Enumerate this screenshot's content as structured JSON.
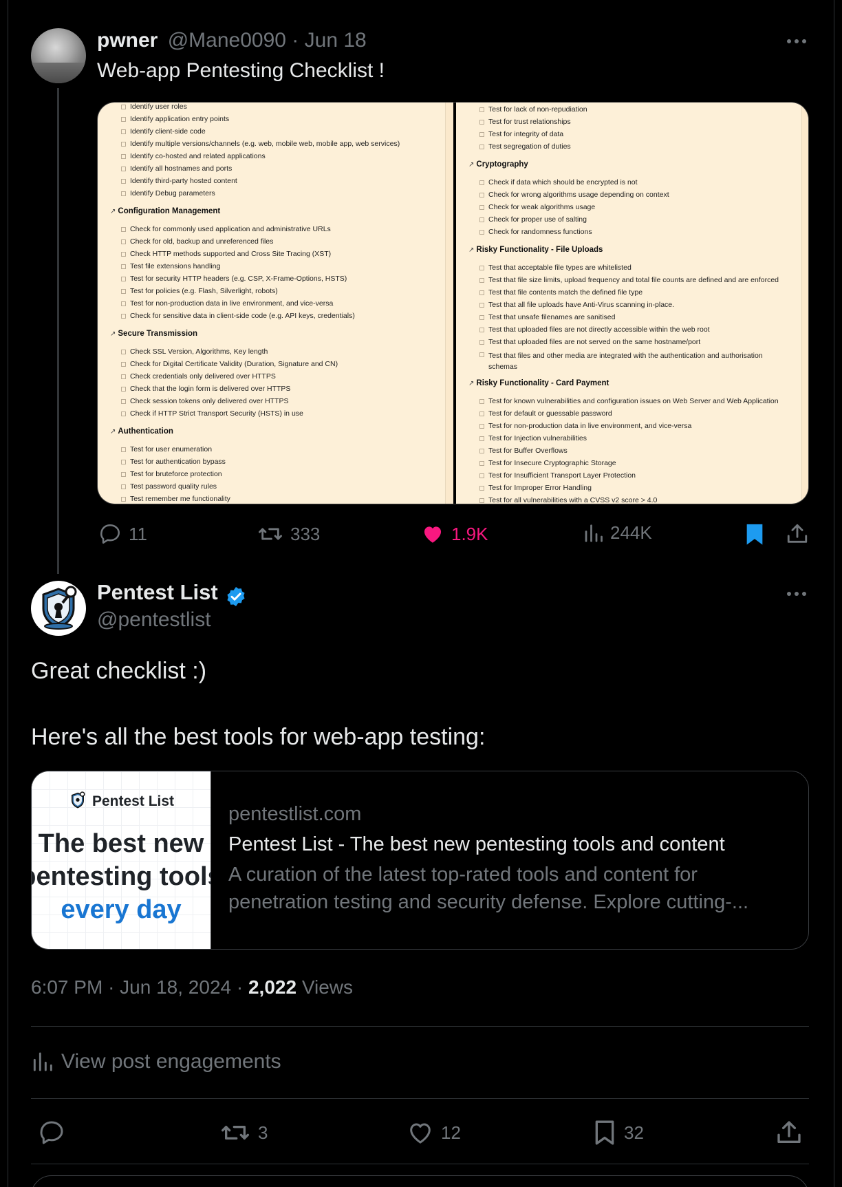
{
  "original_post": {
    "author_name": "pwner",
    "handle": "@Mane0090",
    "separator": "·",
    "date": "Jun 18",
    "text": "Web-app Pentesting Checklist !",
    "stats": {
      "replies": "11",
      "reposts": "333",
      "likes": "1.9K",
      "views": "244K"
    },
    "checklist_left": [
      {
        "type": "item",
        "text": "Identify user roles"
      },
      {
        "type": "item",
        "text": "Identify application entry points"
      },
      {
        "type": "item",
        "text": "Identify client-side code"
      },
      {
        "type": "item",
        "text": "Identify multiple versions/channels (e.g. web, mobile web, mobile app, web services)"
      },
      {
        "type": "item",
        "text": "Identify co-hosted and related applications"
      },
      {
        "type": "item",
        "text": "Identify all hostnames and ports"
      },
      {
        "type": "item",
        "text": "Identify third-party hosted content"
      },
      {
        "type": "item",
        "text": "Identify Debug parameters"
      },
      {
        "type": "section",
        "text": "Configuration Management"
      },
      {
        "type": "item",
        "text": "Check for commonly used application and administrative URLs"
      },
      {
        "type": "item",
        "text": "Check for old, backup and unreferenced files"
      },
      {
        "type": "item",
        "text": "Check HTTP methods supported and Cross Site Tracing (XST)"
      },
      {
        "type": "item",
        "text": "Test file extensions handling"
      },
      {
        "type": "item",
        "text": "Test for security HTTP headers (e.g. CSP, X-Frame-Options, HSTS)"
      },
      {
        "type": "item",
        "text": "Test for policies (e.g. Flash, Silverlight, robots)"
      },
      {
        "type": "item",
        "text": "Test for non-production data in live environment, and vice-versa"
      },
      {
        "type": "item",
        "text": "Check for sensitive data in client-side code (e.g. API keys, credentials)"
      },
      {
        "type": "section",
        "text": "Secure Transmission"
      },
      {
        "type": "item",
        "text": "Check SSL Version, Algorithms, Key length"
      },
      {
        "type": "item",
        "text": "Check for Digital Certificate Validity (Duration, Signature and CN)"
      },
      {
        "type": "item",
        "text": "Check credentials only delivered over HTTPS"
      },
      {
        "type": "item",
        "text": "Check that the login form is delivered over HTTPS"
      },
      {
        "type": "item",
        "text": "Check session tokens only delivered over HTTPS"
      },
      {
        "type": "item",
        "text": "Check if HTTP Strict Transport Security (HSTS) in use"
      },
      {
        "type": "section",
        "text": "Authentication"
      },
      {
        "type": "item",
        "text": "Test for user enumeration"
      },
      {
        "type": "item",
        "text": "Test for authentication bypass"
      },
      {
        "type": "item",
        "text": "Test for bruteforce protection"
      },
      {
        "type": "item",
        "text": "Test password quality rules"
      },
      {
        "type": "item",
        "text": "Test remember me functionality"
      }
    ],
    "checklist_right": [
      {
        "type": "item",
        "text": "Test for lack of non-repudiation"
      },
      {
        "type": "item",
        "text": "Test for trust relationships"
      },
      {
        "type": "item",
        "text": "Test for integrity of data"
      },
      {
        "type": "item",
        "text": "Test segregation of duties"
      },
      {
        "type": "section",
        "text": "Cryptography"
      },
      {
        "type": "item",
        "text": "Check if data which should be encrypted is not"
      },
      {
        "type": "item",
        "text": "Check for wrong algorithms usage depending on context"
      },
      {
        "type": "item",
        "text": "Check for weak algorithms usage"
      },
      {
        "type": "item",
        "text": "Check for proper use of salting"
      },
      {
        "type": "item",
        "text": "Check for randomness functions"
      },
      {
        "type": "section",
        "text": "Risky Functionality - File Uploads"
      },
      {
        "type": "item",
        "text": "Test that acceptable file types are whitelisted"
      },
      {
        "type": "item",
        "text": "Test that file size limits, upload frequency and total file counts are defined and are enforced"
      },
      {
        "type": "item",
        "text": "Test that file contents match the defined file type"
      },
      {
        "type": "item",
        "text": "Test that all file uploads have Anti-Virus scanning in-place."
      },
      {
        "type": "item",
        "text": "Test that unsafe filenames are sanitised"
      },
      {
        "type": "item",
        "text": "Test that uploaded files are not directly accessible within the web root"
      },
      {
        "type": "item",
        "text": "Test that uploaded files are not served on the same hostname/port"
      },
      {
        "type": "item_wrap",
        "text": "Test that files and other media are integrated with the authentication and authorisation schemas"
      },
      {
        "type": "section",
        "text": "Risky Functionality - Card Payment"
      },
      {
        "type": "item",
        "text": "Test for known vulnerabilities and configuration issues on Web Server and Web Application"
      },
      {
        "type": "item",
        "text": "Test for default or guessable password"
      },
      {
        "type": "item",
        "text": "Test for non-production data in live environment, and vice-versa"
      },
      {
        "type": "item",
        "text": "Test for Injection vulnerabilities"
      },
      {
        "type": "item",
        "text": "Test for Buffer Overflows"
      },
      {
        "type": "item",
        "text": "Test for Insecure Cryptographic Storage"
      },
      {
        "type": "item",
        "text": "Test for Insufficient Transport Layer Protection"
      },
      {
        "type": "item",
        "text": "Test for Improper Error Handling"
      },
      {
        "type": "item",
        "text": "Test for all vulnerabilities with a CVSS v2 score > 4.0"
      }
    ]
  },
  "reply_post": {
    "author_name": "Pentest List",
    "handle": "@pentestlist",
    "text_line1": "Great checklist :)",
    "text_line2": "Here's all the best tools for web-app testing:",
    "card": {
      "image_brand": "Pentest List",
      "image_line1": "The best new",
      "image_line2": "pentesting tools",
      "image_line3": "every day",
      "domain": "pentestlist.com",
      "title": "Pentest List - The best new pentesting tools and content",
      "description_line1": "A curation of the latest top-rated tools and content for",
      "description_line2": "penetration testing and security defense. Explore cutting-..."
    },
    "time": "6:07 PM",
    "separator": "·",
    "date": "Jun 18, 2024",
    "views_count": "2,022",
    "views_label": "Views",
    "engagements_label": "View post engagements",
    "stats": {
      "reposts": "3",
      "likes": "12",
      "bookmarks": "32"
    }
  },
  "colors": {
    "background": "#000000",
    "text": "#e7e9ea",
    "muted": "#71767b",
    "like": "#f91880",
    "accent": "#1d9bf0",
    "checklist_bg": "#fdf0d8"
  },
  "icons": [
    "more-icon",
    "reply-icon",
    "repost-icon",
    "like-icon",
    "views-icon",
    "bookmark-icon",
    "share-icon",
    "verified-badge-icon",
    "analytics-icon",
    "link-icon"
  ]
}
